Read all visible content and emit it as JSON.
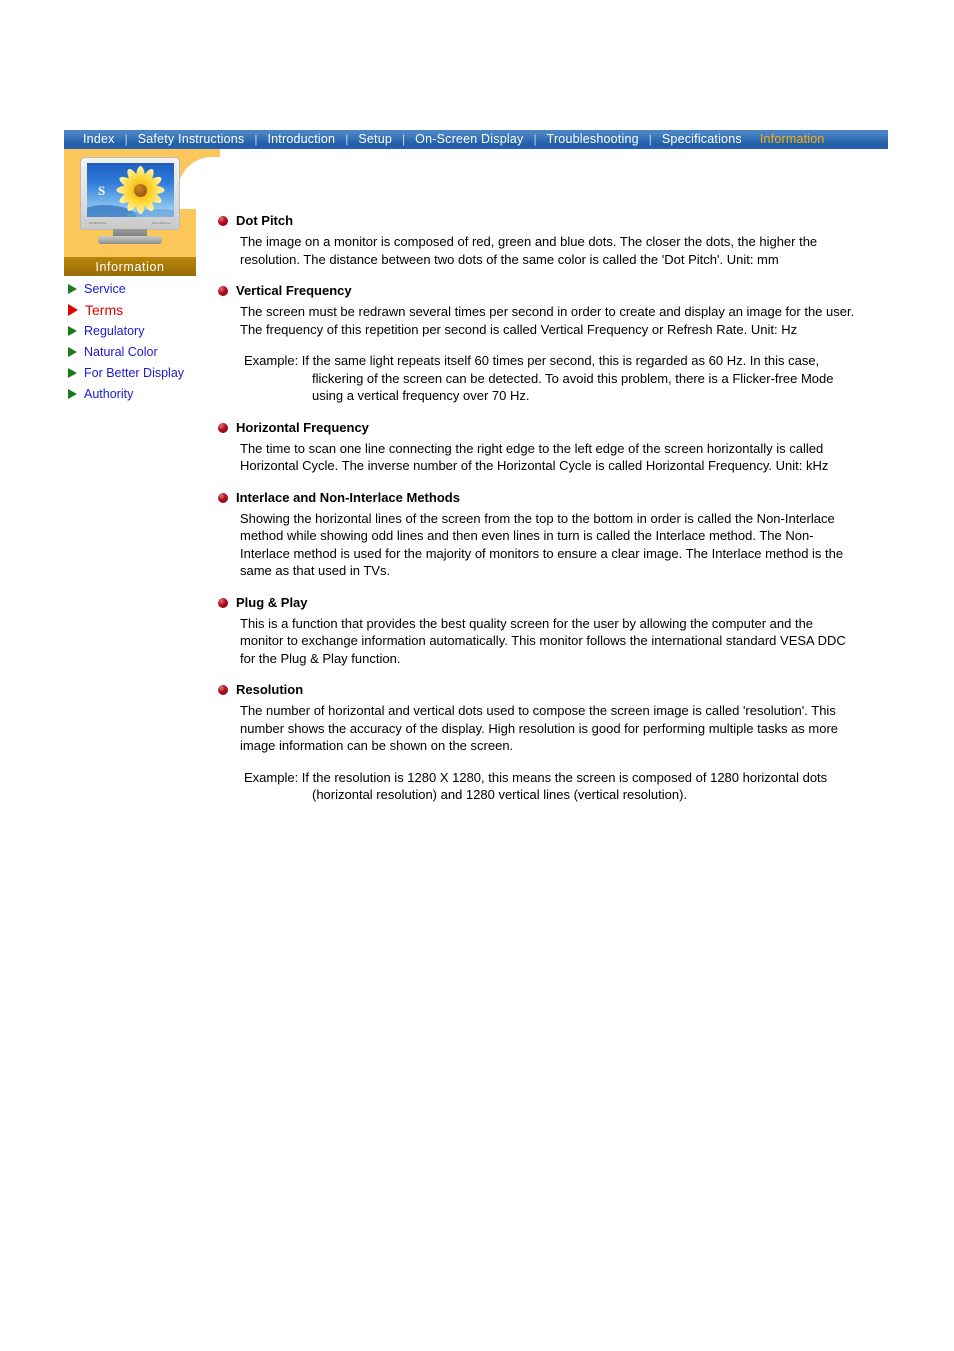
{
  "nav": {
    "items": [
      {
        "label": "Index",
        "active": false
      },
      {
        "label": "Safety Instructions",
        "active": false
      },
      {
        "label": "Introduction",
        "active": false
      },
      {
        "label": "Setup",
        "active": false
      },
      {
        "label": "On-Screen Display",
        "active": false
      },
      {
        "label": "Troubleshooting",
        "active": false
      },
      {
        "label": "Specifications",
        "active": false
      },
      {
        "label": "Information",
        "active": true
      }
    ],
    "separator": "|",
    "bg_color": "#2f6cb3",
    "text_color": "#ffffff",
    "active_color": "#ffae00"
  },
  "sidebar": {
    "panel_color": "#fbc75a",
    "section_label": "Information",
    "section_label_bg": "#b8860b",
    "monitor": {
      "brand_left": "SAMSUNG",
      "brand_right": "SyncMaster",
      "screen_letter": "S"
    },
    "items": [
      {
        "label": "Service",
        "active": false
      },
      {
        "label": "Terms",
        "active": true
      },
      {
        "label": "Regulatory",
        "active": false
      },
      {
        "label": "Natural Color",
        "active": false
      },
      {
        "label": "For Better Display",
        "active": false
      },
      {
        "label": "Authority",
        "active": false
      }
    ],
    "link_color": "#1a1ad0",
    "active_link_color": "#e00000",
    "bullet_color": "#1a7a1a",
    "active_bullet_color": "#e00000"
  },
  "content": {
    "bullet_color": "#b01020",
    "sections": [
      {
        "title": "Dot Pitch",
        "body": "The image on a monitor is composed of red, green and blue dots. The closer the dots, the higher the resolution. The distance between two dots of the same color is called the 'Dot Pitch'. Unit: mm"
      },
      {
        "title": "Vertical Frequency",
        "body": "The screen must be redrawn several times per second in order to create and display an image for the user. The frequency of this repetition per second is called Vertical Frequency or Refresh Rate. Unit: Hz",
        "example": "Example: If the same light repeats itself 60 times per second, this is regarded as 60 Hz. In this case, flickering of the screen can be detected. To avoid this problem, there is a Flicker-free Mode using a vertical frequency over 70 Hz."
      },
      {
        "title": "Horizontal Frequency",
        "body": "The time to scan one line connecting the right edge to the left edge of the screen horizontally is called Horizontal Cycle. The inverse number of the Horizontal Cycle is called Horizontal Frequency. Unit: kHz"
      },
      {
        "title": "Interlace and Non-Interlace Methods",
        "body": "Showing the horizontal lines of the screen from the top to the bottom in order is called the Non-Interlace method while showing odd lines and then even lines in turn is called the Interlace method. The Non-Interlace method is used for the majority of monitors to ensure a clear image. The Interlace method is the same as that used in TVs."
      },
      {
        "title": "Plug & Play",
        "body": "This is a function that provides the best quality screen for the user by allowing the computer and the monitor to exchange information automatically. This monitor follows the international standard VESA DDC for the Plug & Play function."
      },
      {
        "title": "Resolution",
        "body": "The number of horizontal and vertical dots used to compose the screen image is called 'resolution'. This number shows the accuracy of the display. High resolution is good for performing multiple tasks as more image information can be shown on the screen.",
        "example": "Example: If the resolution is 1280 X 1280, this means the screen is composed of 1280 horizontal dots (horizontal resolution) and 1280 vertical lines (vertical resolution)."
      }
    ]
  }
}
